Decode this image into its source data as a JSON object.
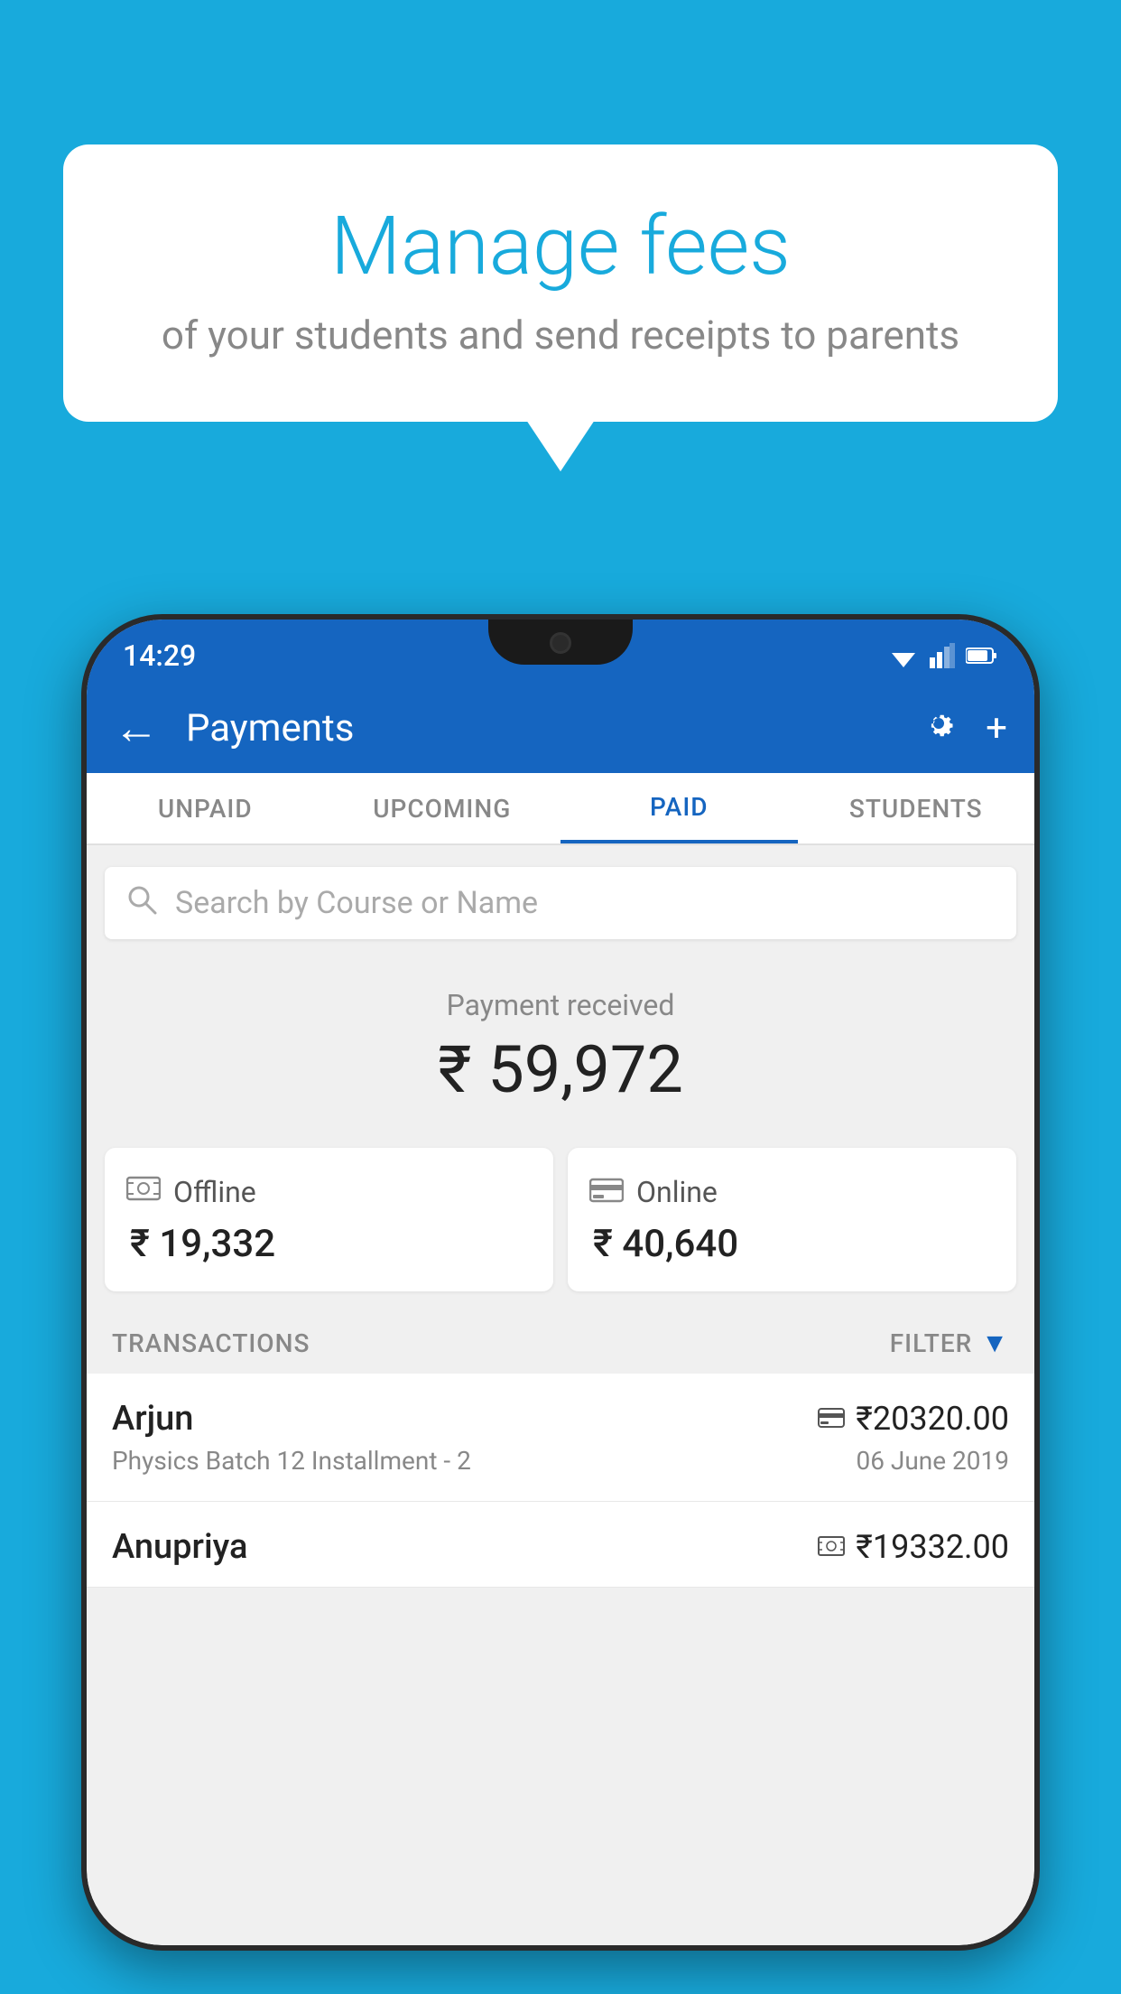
{
  "background_color": "#18AADC",
  "bubble": {
    "title": "Manage fees",
    "subtitle": "of your students and send receipts to parents"
  },
  "status_bar": {
    "time": "14:29"
  },
  "app_bar": {
    "title": "Payments",
    "back_label": "←",
    "settings_label": "⚙",
    "add_label": "+"
  },
  "tabs": [
    {
      "label": "UNPAID",
      "active": false
    },
    {
      "label": "UPCOMING",
      "active": false
    },
    {
      "label": "PAID",
      "active": true
    },
    {
      "label": "STUDENTS",
      "active": false
    }
  ],
  "search": {
    "placeholder": "Search by Course or Name"
  },
  "payment": {
    "label": "Payment received",
    "amount": "₹ 59,972",
    "offline": {
      "type": "Offline",
      "amount": "₹ 19,332"
    },
    "online": {
      "type": "Online",
      "amount": "₹ 40,640"
    }
  },
  "transactions": {
    "label": "TRANSACTIONS",
    "filter_label": "FILTER",
    "items": [
      {
        "name": "Arjun",
        "amount": "₹20320.00",
        "course": "Physics Batch 12 Installment - 2",
        "date": "06 June 2019",
        "payment_type": "online"
      },
      {
        "name": "Anupriya",
        "amount": "₹19332.00",
        "course": "",
        "date": "",
        "payment_type": "offline"
      }
    ]
  }
}
